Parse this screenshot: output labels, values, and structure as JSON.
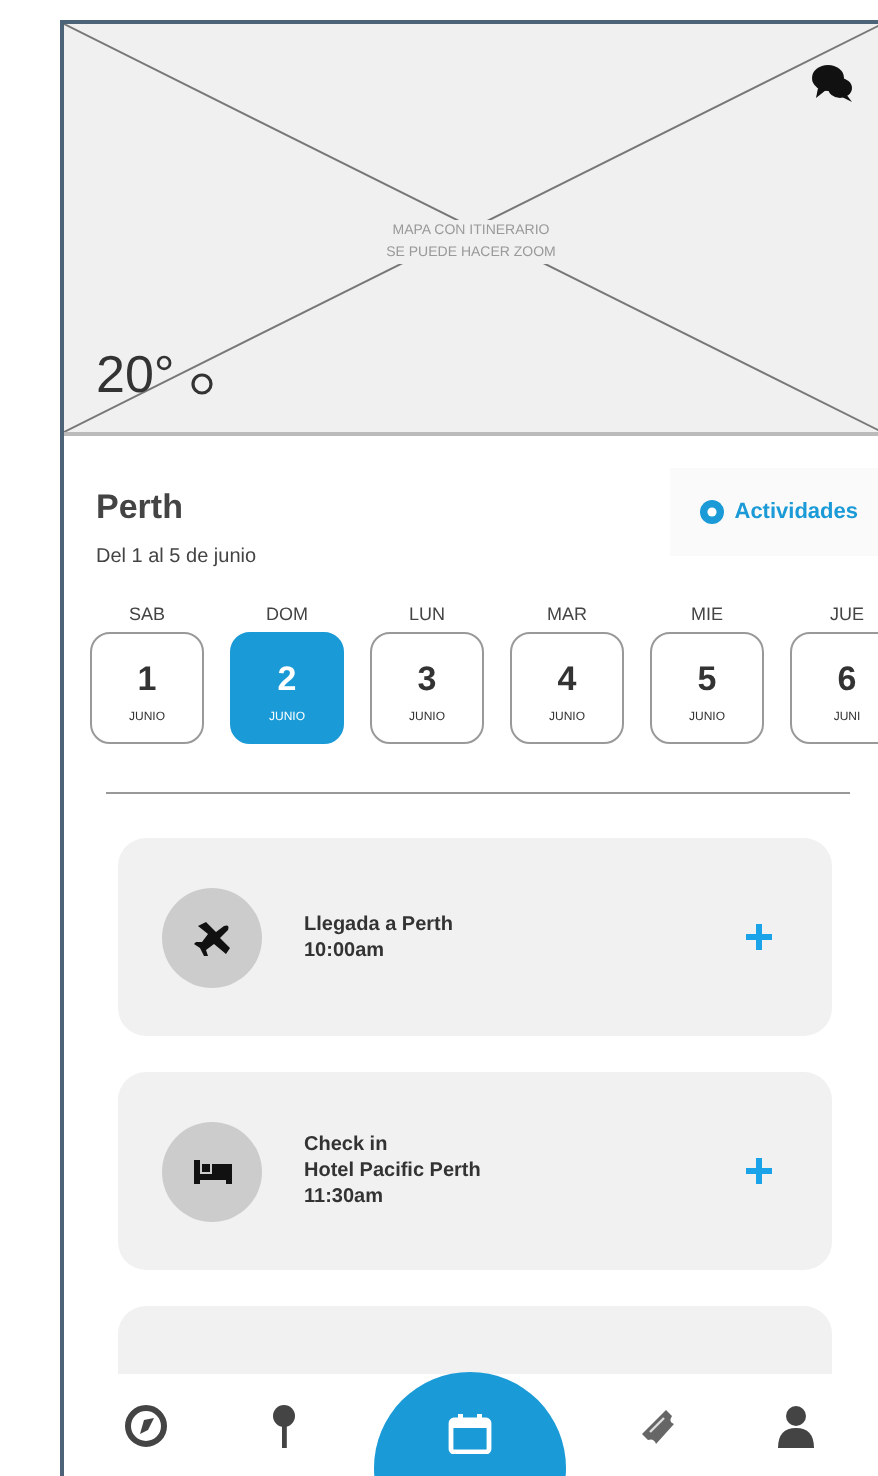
{
  "map": {
    "caption_lines": [
      "MAPA CON ITINERARIO",
      "SE PUEDE HACER ZOOM"
    ],
    "temperature": "20°"
  },
  "trip": {
    "city": "Perth",
    "dates": "Del 1 al 5 de junio",
    "action": "Actividades"
  },
  "days": [
    {
      "weekday": "SAB",
      "day": "1",
      "month": "JUNIO",
      "selected": false
    },
    {
      "weekday": "DOM",
      "day": "2",
      "month": "JUNIO",
      "selected": true
    },
    {
      "weekday": "LUN",
      "day": "3",
      "month": "JUNIO",
      "selected": false
    },
    {
      "weekday": "MAR",
      "day": "4",
      "month": "JUNIO",
      "selected": false
    },
    {
      "weekday": "MIE",
      "day": "5",
      "month": "JUNIO",
      "selected": false
    },
    {
      "weekday": "JUE",
      "day": "6",
      "month": "JUNI",
      "selected": false
    }
  ],
  "events": [
    {
      "kind": "flight",
      "lines": [
        "Llegada a Perth",
        "10:00am"
      ]
    },
    {
      "kind": "hotel",
      "lines": [
        "Check in",
        "Hotel Pacific Perth",
        "11:30am"
      ]
    },
    {
      "kind": "blank"
    }
  ],
  "nav": [
    {
      "kind": "explore",
      "selected": false
    },
    {
      "kind": "pin",
      "selected": false
    },
    {
      "kind": "calendar",
      "selected": true
    },
    {
      "kind": "ticket",
      "selected": false
    },
    {
      "kind": "profile",
      "selected": false
    }
  ]
}
